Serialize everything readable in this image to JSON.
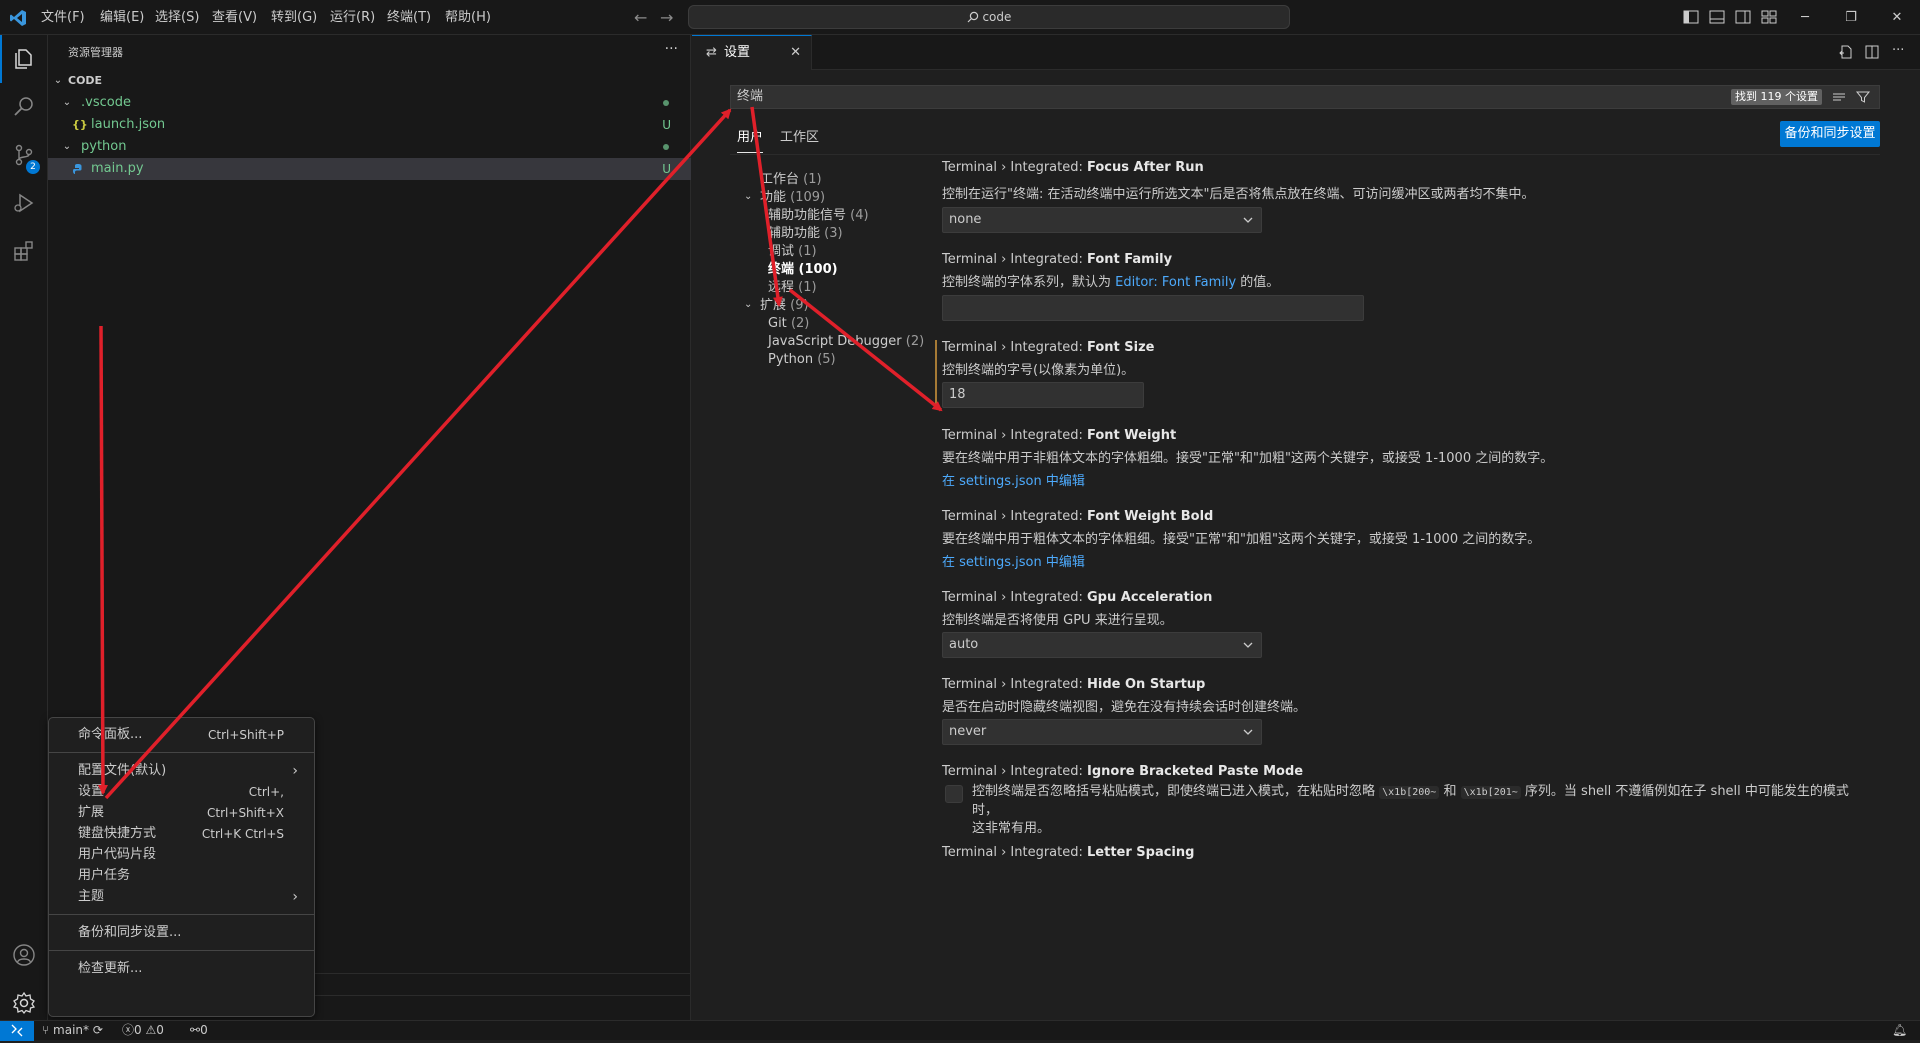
{
  "titlebar": {
    "menus": [
      "文件(F)",
      "编辑(E)",
      "选择(S)",
      "查看(V)",
      "转到(G)",
      "运行(R)",
      "终端(T)",
      "帮助(H)"
    ],
    "search_text": "code"
  },
  "sidebar": {
    "title": "资源管理器",
    "more": "···",
    "root": "CODE",
    "tree": [
      {
        "label": ".vscode",
        "type": "folder",
        "status": "dot"
      },
      {
        "label": "launch.json",
        "type": "json",
        "status": "U"
      },
      {
        "label": "python",
        "type": "folder",
        "status": "dot"
      },
      {
        "label": "main.py",
        "type": "py",
        "status": "U"
      }
    ]
  },
  "context_menu": {
    "items": [
      {
        "label": "命令面板...",
        "shortcut": "Ctrl+Shift+P"
      },
      {
        "label": "配置文件(默认)",
        "shortcut": ""
      },
      {
        "label": "设置",
        "shortcut": "Ctrl+,"
      },
      {
        "label": "扩展",
        "shortcut": "Ctrl+Shift+X"
      },
      {
        "label": "键盘快捷方式",
        "shortcut": "Ctrl+K Ctrl+S"
      },
      {
        "label": "用户代码片段",
        "shortcut": ""
      },
      {
        "label": "用户任务",
        "shortcut": ""
      },
      {
        "label": "主题",
        "shortcut": ""
      },
      {
        "label": "备份和同步设置...",
        "shortcut": ""
      },
      {
        "label": "检查更新...",
        "shortcut": ""
      }
    ]
  },
  "editor": {
    "tab_label": "设置",
    "search_value": "终端",
    "result_count": "找到 119 个设置",
    "scope_tabs": [
      "用户",
      "工作区"
    ],
    "sync_button": "备份和同步设置",
    "toc": [
      {
        "label": "工作台",
        "count": "(1)"
      },
      {
        "label": "功能",
        "count": "(109)"
      },
      {
        "label": "辅助功能信号",
        "count": "(4)"
      },
      {
        "label": "辅助功能",
        "count": "(3)"
      },
      {
        "label": "调试",
        "count": "(1)"
      },
      {
        "label": "终端",
        "count": "(100)"
      },
      {
        "label": "远程",
        "count": "(1)"
      },
      {
        "label": "扩展",
        "count": "(9)"
      },
      {
        "label": "Git",
        "count": "(2)"
      },
      {
        "label": "JavaScript Debugger",
        "count": "(2)"
      },
      {
        "label": "Python",
        "count": "(5)"
      }
    ],
    "settings": {
      "s0": {
        "prefix": "Terminal › Integrated: ",
        "name": "Focus After Run",
        "desc": "控制在运行\"终端: 在活动终端中运行所选文本\"后是否将焦点放在终端、可访问缓冲区或两者均不集中。",
        "value": "none"
      },
      "s1": {
        "prefix": "Terminal › Integrated: ",
        "name": "Font Family",
        "desc_a": "控制终端的字体系列，默认为 ",
        "desc_link": "Editor: Font Family",
        "desc_b": " 的值。",
        "value": ""
      },
      "s2": {
        "prefix": "Terminal › Integrated: ",
        "name": "Font Size",
        "desc": "控制终端的字号(以像素为单位)。",
        "value": "18"
      },
      "s3": {
        "prefix": "Terminal › Integrated: ",
        "name": "Font Weight",
        "desc": "要在终端中用于非粗体文本的字体粗细。接受\"正常\"和\"加粗\"这两个关键字，或接受 1-1000 之间的数字。",
        "link": "在 settings.json 中编辑"
      },
      "s4": {
        "prefix": "Terminal › Integrated: ",
        "name": "Font Weight Bold",
        "desc": "要在终端中用于粗体文本的字体粗细。接受\"正常\"和\"加粗\"这两个关键字，或接受 1-1000 之间的数字。",
        "link": "在 settings.json 中编辑"
      },
      "s5": {
        "prefix": "Terminal › Integrated: ",
        "name": "Gpu Acceleration",
        "desc": "控制终端是否将使用 GPU 来进行呈现。",
        "value": "auto"
      },
      "s6": {
        "prefix": "Terminal › Integrated: ",
        "name": "Hide On Startup",
        "desc": "是否在启动时隐藏终端视图，避免在没有持续会话时创建终端。",
        "value": "never"
      },
      "s7": {
        "prefix": "Terminal › Integrated: ",
        "name": "Ignore Bracketed Paste Mode",
        "desc_a": "控制终端是否忽略括号粘贴模式，即使终端已进入模式，在粘贴时忽略 ",
        "code1": "\\x1b[200~",
        "desc_mid": " 和 ",
        "code2": "\\x1b[201~",
        "desc_b": " 序列。当 shell 不遵循例如在子 shell 中可能发生的模式时，",
        "desc_c": "这非常有用。"
      },
      "s8": {
        "prefix": "Terminal › Integrated: ",
        "name": "Letter Spacing"
      }
    }
  },
  "statusbar": {
    "branch": "main*",
    "errors": "0",
    "warnings": "0",
    "ports": "0"
  },
  "colors": {
    "accent": "#0078d4",
    "annotation": "#e0202a",
    "modified": "#a67a35"
  }
}
